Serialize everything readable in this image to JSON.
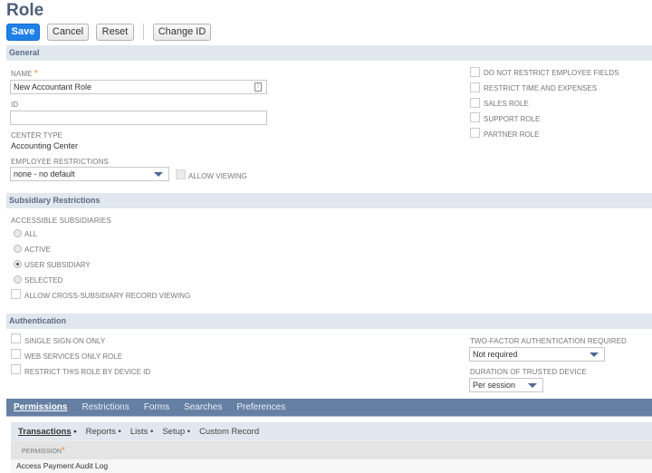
{
  "page": {
    "title": "Role"
  },
  "toolbar": {
    "save_label": "Save",
    "cancel_label": "Cancel",
    "reset_label": "Reset",
    "change_id_label": "Change ID"
  },
  "sections": {
    "general": "General",
    "subsidiary": "Subsidiary Restrictions",
    "authentication": "Authentication"
  },
  "general": {
    "name_label": "NAME",
    "required_mark": "*",
    "name_value": "New Accountant Role",
    "id_label": "ID",
    "id_value": "",
    "center_type_label": "CENTER TYPE",
    "center_type_value": "Accounting Center",
    "employee_restrictions_label": "EMPLOYEE RESTRICTIONS",
    "employee_restrictions_value": "none - no default",
    "allow_viewing_label": "ALLOW VIEWING",
    "checkboxes": [
      {
        "label": "DO NOT RESTRICT EMPLOYEE FIELDS",
        "checked": false
      },
      {
        "label": "RESTRICT TIME AND EXPENSES",
        "checked": false
      },
      {
        "label": "SALES ROLE",
        "checked": false
      },
      {
        "label": "SUPPORT ROLE",
        "checked": false
      },
      {
        "label": "PARTNER ROLE",
        "checked": false
      }
    ]
  },
  "subsidiary": {
    "accessible_label": "ACCESSIBLE SUBSIDIARIES",
    "options": [
      {
        "label": "ALL",
        "checked": false
      },
      {
        "label": "ACTIVE",
        "checked": false
      },
      {
        "label": "USER SUBSIDIARY",
        "checked": true
      },
      {
        "label": "SELECTED",
        "checked": false
      }
    ],
    "cross_subsidiary_label": "ALLOW CROSS-SUBSIDIARY RECORD VIEWING"
  },
  "authentication": {
    "checkboxes": [
      {
        "label": "SINGLE SIGN-ON ONLY",
        "checked": false
      },
      {
        "label": "WEB SERVICES ONLY ROLE",
        "checked": false
      },
      {
        "label": "RESTRICT THIS ROLE BY DEVICE ID",
        "checked": false
      }
    ],
    "two_factor_label": "TWO-FACTOR AUTHENTICATION REQUIRED",
    "two_factor_value": "Not required",
    "trusted_device_label": "DURATION OF TRUSTED DEVICE",
    "trusted_device_value": "Per session"
  },
  "tabs": [
    {
      "label": "Permissions",
      "active": true
    },
    {
      "label": "Restrictions",
      "active": false
    },
    {
      "label": "Forms",
      "active": false
    },
    {
      "label": "Searches",
      "active": false
    },
    {
      "label": "Preferences",
      "active": false
    }
  ],
  "subtabs": [
    {
      "label": "Transactions",
      "active": true
    },
    {
      "label": "Reports",
      "active": false
    },
    {
      "label": "Lists",
      "active": false
    },
    {
      "label": "Setup",
      "active": false
    },
    {
      "label": "Custom Record",
      "active": false
    }
  ],
  "subtab_separator": "•",
  "permissions_table": {
    "header": "PERMISSION",
    "rows": [
      "Access Payment Audit Log"
    ]
  },
  "colors": {
    "primary_button": "#1f80e8",
    "section_header_bg": "#e1e7ef",
    "tab_bar_bg": "#6680a4",
    "title": "#4d5f79",
    "required": "#e88c2a"
  }
}
